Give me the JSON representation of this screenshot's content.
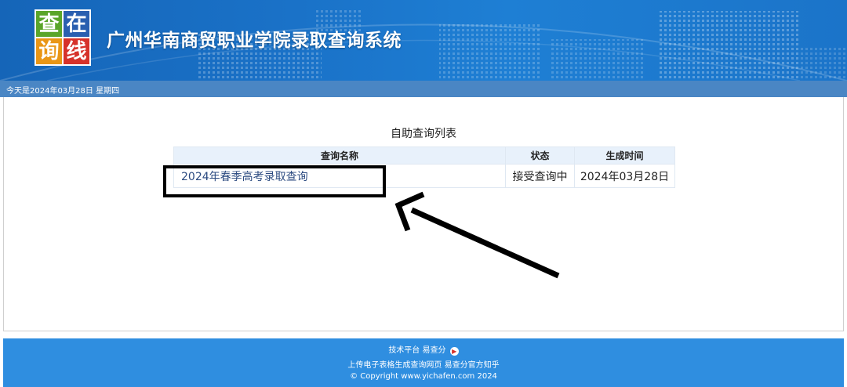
{
  "header": {
    "logo_chars": [
      "查",
      "在",
      "询",
      "线"
    ],
    "title": "广州华南商贸职业学院录取查询系统"
  },
  "datebar": {
    "text": "今天是2024年03月28日  星期四"
  },
  "main": {
    "list_title": "自助查询列表",
    "table": {
      "columns": [
        "查询名称",
        "状态",
        "生成时间"
      ],
      "rows": [
        {
          "name": "2024年春季高考录取查询",
          "state": "接受查询中",
          "date": "2024年03月28日"
        }
      ]
    }
  },
  "footer": {
    "tech_platform": "技术平台 易查分",
    "links": "上传电子表格生成查询网页 易查分官方知乎",
    "copyright": "© Copyright www.yichafen.com 2024"
  },
  "colors": {
    "header_bg": "#1a72c8",
    "datebar_bg": "#4a86c4",
    "footer_bg": "#2f8ee0",
    "table_header_bg": "#e8f1fb",
    "link_color": "#2b4a80"
  },
  "icons": [
    "globe-map-graphic",
    "yichafen-logo-icon",
    "annotation-arrow-icon"
  ]
}
